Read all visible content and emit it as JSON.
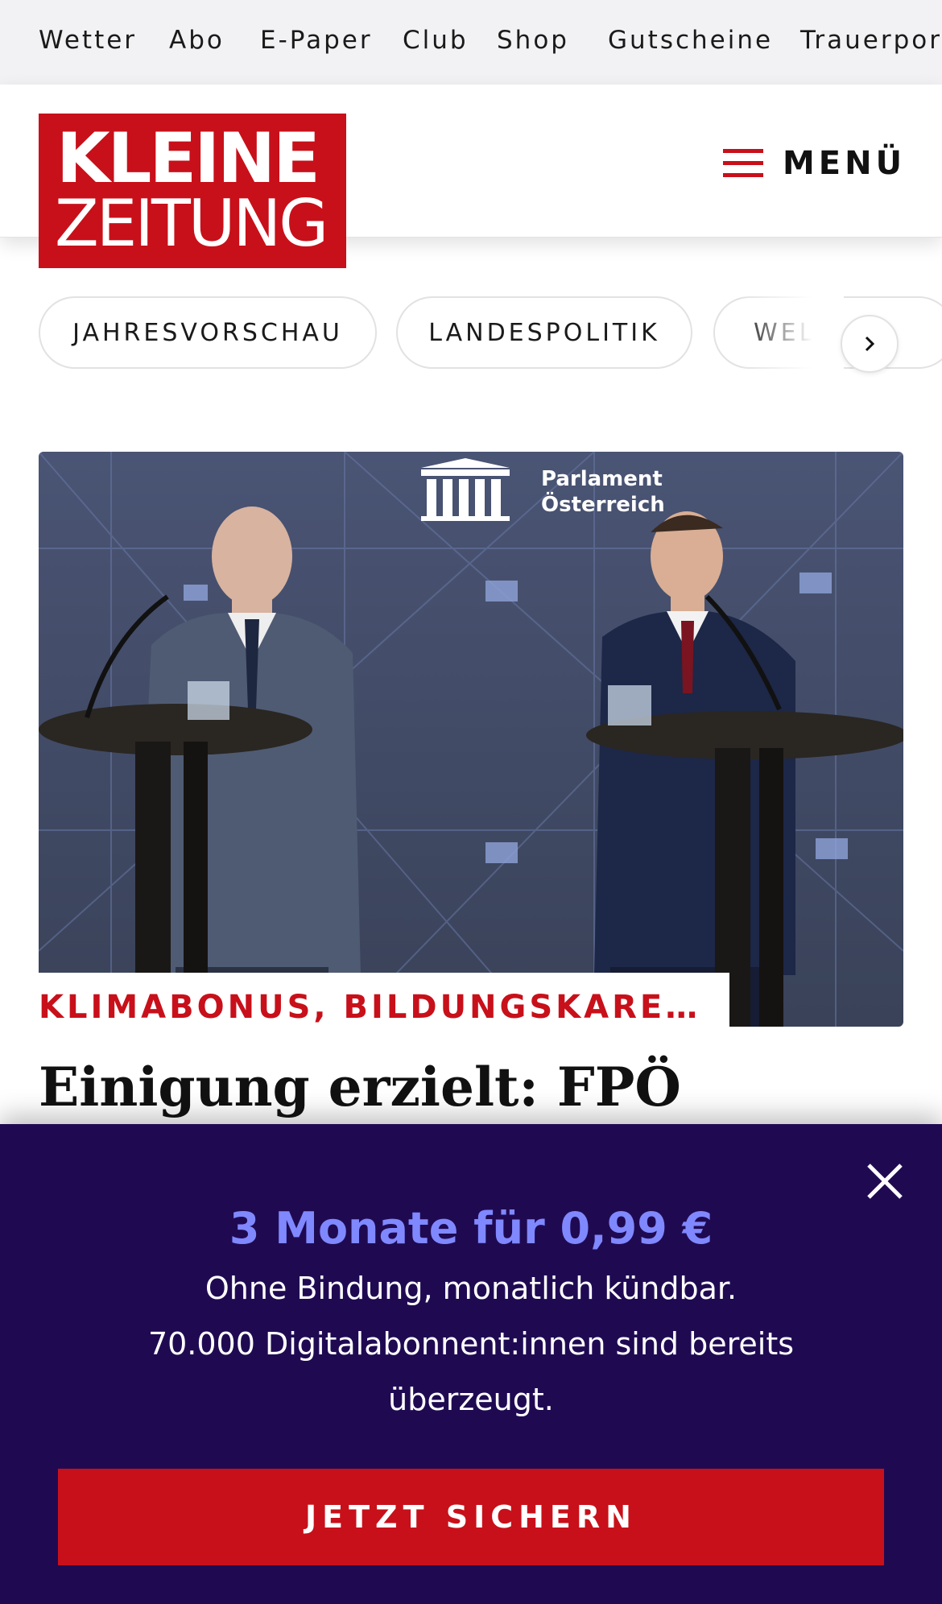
{
  "topnav": {
    "items": [
      "Wetter",
      "Abo",
      "E-Paper",
      "Club",
      "Shop",
      "Gutscheine",
      "Trauerportal"
    ]
  },
  "header": {
    "logo_line1": "KLEINE",
    "logo_line2": "ZEITUNG",
    "menu_label": "MENÜ"
  },
  "chips": {
    "items": [
      "JAHRESVORSCHAU",
      "LANDESPOLITIK",
      "WELT"
    ]
  },
  "article": {
    "image_text_line1": "Parlament",
    "image_text_line2": "Österreich",
    "kicker": "KLIMABONUS, BILDUNGSKARENZ, S…",
    "headline": "Einigung erzielt: FPÖ"
  },
  "paywall": {
    "offer": "3 Monate für 0,99 €",
    "line1": "Ohne Bindung, monatlich kündbar.",
    "line2": "70.000 Digitalabonnent:innen sind bereits",
    "line3": "überzeugt.",
    "cta": "JETZT SICHERN"
  },
  "colors": {
    "brand_red": "#c8101a",
    "paywall_bg": "#1f0a52",
    "offer_accent": "#8088ff"
  },
  "icons": [
    "hamburger-menu-icon",
    "chevron-right-icon",
    "close-icon",
    "parliament-icon"
  ]
}
